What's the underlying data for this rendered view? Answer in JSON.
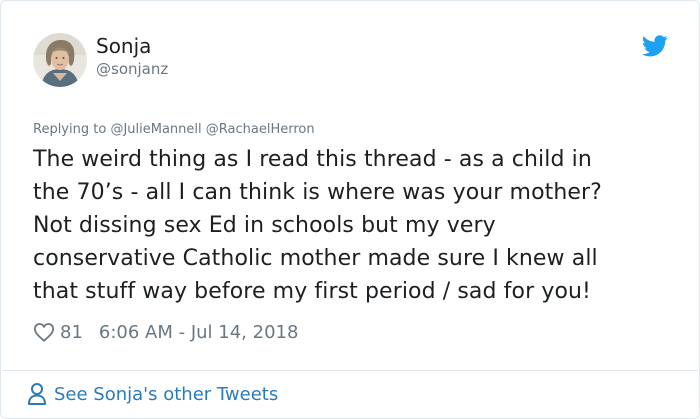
{
  "author": {
    "name": "Sonja",
    "handle": "@sonjanz"
  },
  "reply": {
    "prefix": "Replying to",
    "mentions": [
      "@JulieMannell",
      "@RachaelHerron"
    ]
  },
  "tweet": {
    "lines": [
      "The weird thing as I read this thread - as a child in",
      "the 70’s - all I can think is where was your mother?",
      "Not dissing sex Ed in schools but my very",
      "conservative Catholic mother made sure I knew all",
      "that stuff way before my first period / sad for you!"
    ]
  },
  "meta": {
    "likes": "81",
    "timestamp": "6:06 AM - Jul 14, 2018"
  },
  "footer": {
    "more_label": "See Sonja's other Tweets"
  },
  "icons": {
    "brand": "twitter-bird-icon",
    "like": "heart-icon",
    "profile": "person-icon"
  },
  "colors": {
    "twitter_blue": "#1da1f2",
    "link_blue": "#2b7bb9",
    "text_primary": "#1c2022",
    "text_secondary": "#697882",
    "border": "#e1e8ed"
  }
}
